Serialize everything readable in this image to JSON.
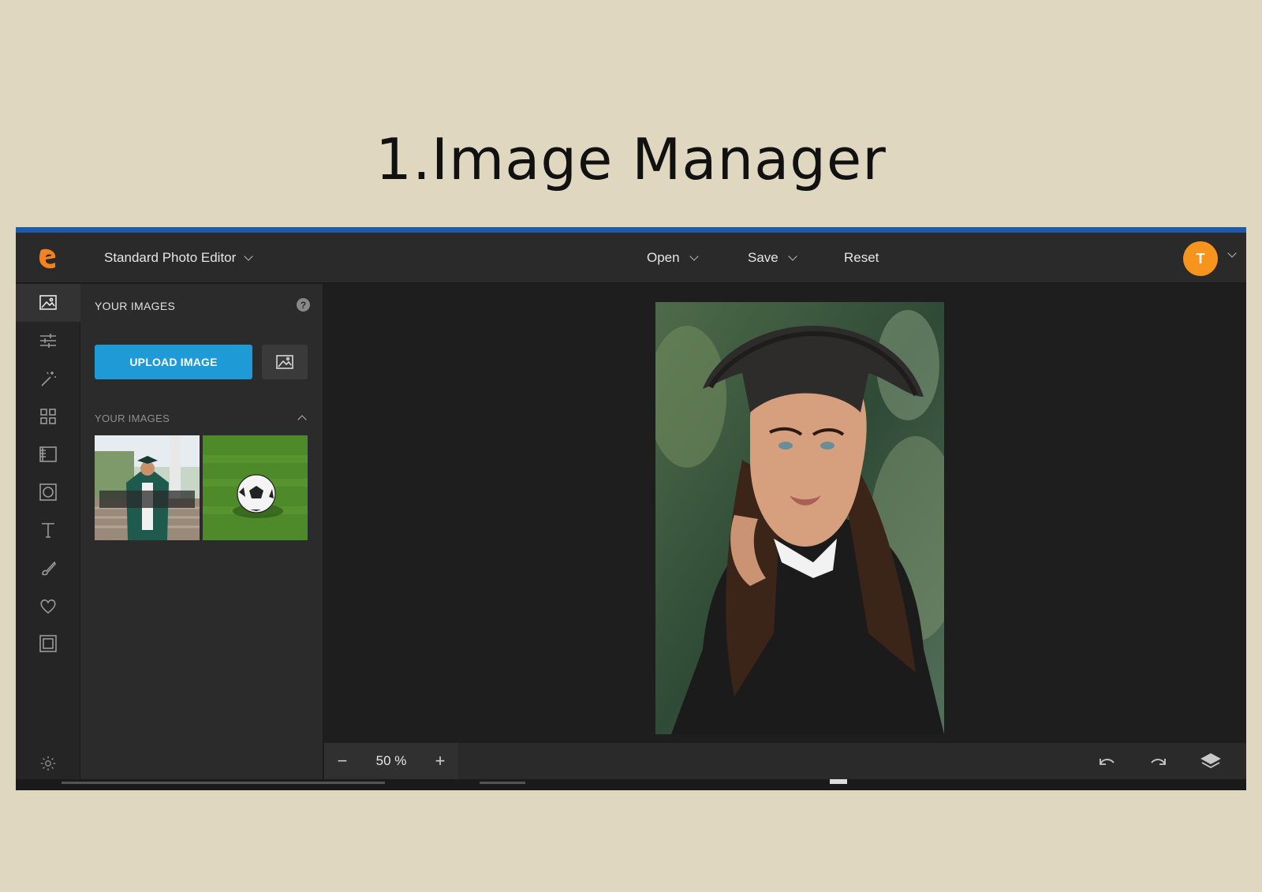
{
  "slide": {
    "title": "1.Image Manager"
  },
  "topbar": {
    "app_title": "Standard Photo Editor",
    "menu": {
      "open": "Open",
      "save": "Save",
      "reset": "Reset"
    },
    "avatar_initial": "T"
  },
  "tools": [
    {
      "name": "image-manager-icon"
    },
    {
      "name": "adjustments-icon"
    },
    {
      "name": "magic-wand-icon"
    },
    {
      "name": "grid-icon"
    },
    {
      "name": "texture-icon"
    },
    {
      "name": "vignette-icon"
    },
    {
      "name": "text-icon"
    },
    {
      "name": "brush-icon"
    },
    {
      "name": "heart-icon"
    },
    {
      "name": "frame-icon"
    }
  ],
  "panel": {
    "header": "YOUR IMAGES",
    "help": "?",
    "upload_label": "UPLOAD IMAGE",
    "section_label": "YOUR IMAGES",
    "thumbnails": [
      "graduate-photo",
      "soccer-ball-photo"
    ]
  },
  "bottombar": {
    "zoom_minus": "−",
    "zoom_value": "50 %",
    "zoom_plus": "+"
  },
  "colors": {
    "accent": "#1e9bd7",
    "top_accent": "#1d5aa8",
    "avatar": "#f7941d",
    "background": "#e0d7c1"
  }
}
